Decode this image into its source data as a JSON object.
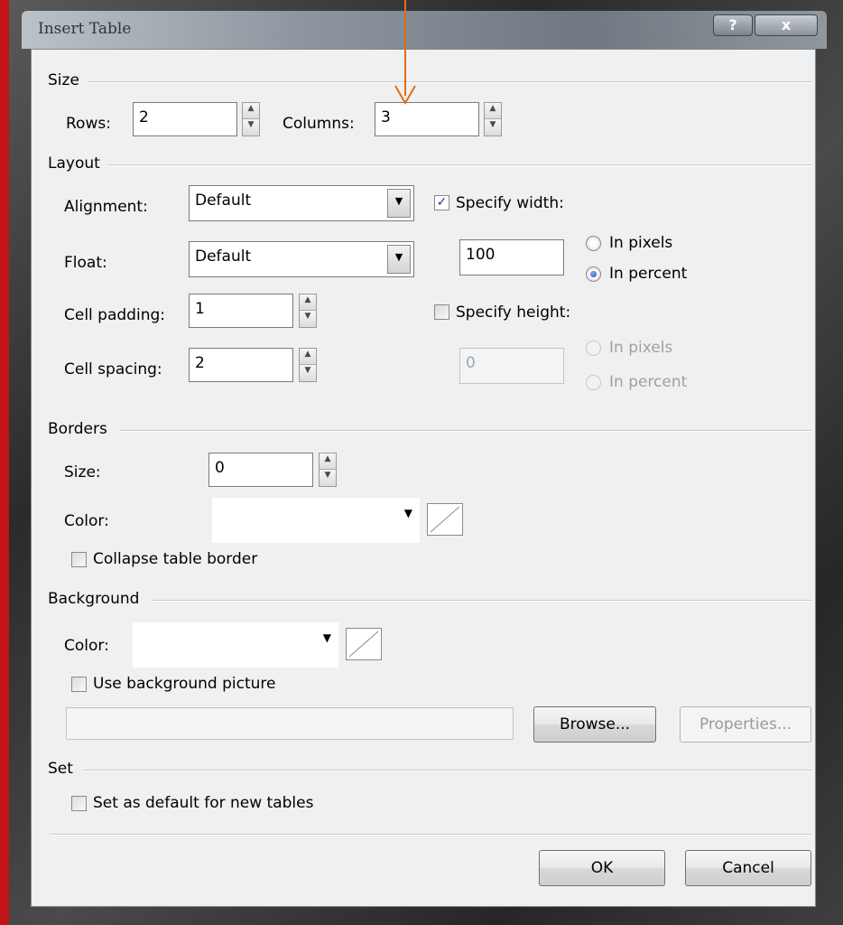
{
  "window": {
    "title": "Insert Table",
    "help_label": "?",
    "close_label": "x"
  },
  "size_group": {
    "label": "Size",
    "rows_label": "Rows:",
    "rows_value": "2",
    "columns_label": "Columns:",
    "columns_value": "3"
  },
  "layout_group": {
    "label": "Layout",
    "alignment_label": "Alignment:",
    "alignment_value": "Default",
    "float_label": "Float:",
    "float_value": "Default",
    "cell_padding_label": "Cell padding:",
    "cell_padding_value": "1",
    "cell_spacing_label": "Cell spacing:",
    "cell_spacing_value": "2",
    "specify_width_label": "Specify width:",
    "specify_width_checked": true,
    "width_value": "100",
    "width_in_pixels_label": "In pixels",
    "width_in_percent_label": "In percent",
    "width_unit_selected": "percent",
    "specify_height_label": "Specify height:",
    "specify_height_checked": false,
    "height_value": "0",
    "height_in_pixels_label": "In pixels",
    "height_in_percent_label": "In percent"
  },
  "borders_group": {
    "label": "Borders",
    "size_label": "Size:",
    "size_value": "0",
    "color_label": "Color:",
    "collapse_label": "Collapse table border",
    "collapse_checked": false
  },
  "background_group": {
    "label": "Background",
    "color_label": "Color:",
    "use_picture_label": "Use background picture",
    "use_picture_checked": false,
    "picture_path": "",
    "browse_label": "Browse...",
    "properties_label": "Properties..."
  },
  "set_group": {
    "label": "Set",
    "default_label": "Set as default for new tables",
    "default_checked": false
  },
  "footer": {
    "ok_label": "OK",
    "cancel_label": "Cancel"
  },
  "colors": {
    "annotation_arrow": "#e36b1a",
    "frame_border": "#c0141a",
    "dialog_bg": "#f0f0f0"
  }
}
